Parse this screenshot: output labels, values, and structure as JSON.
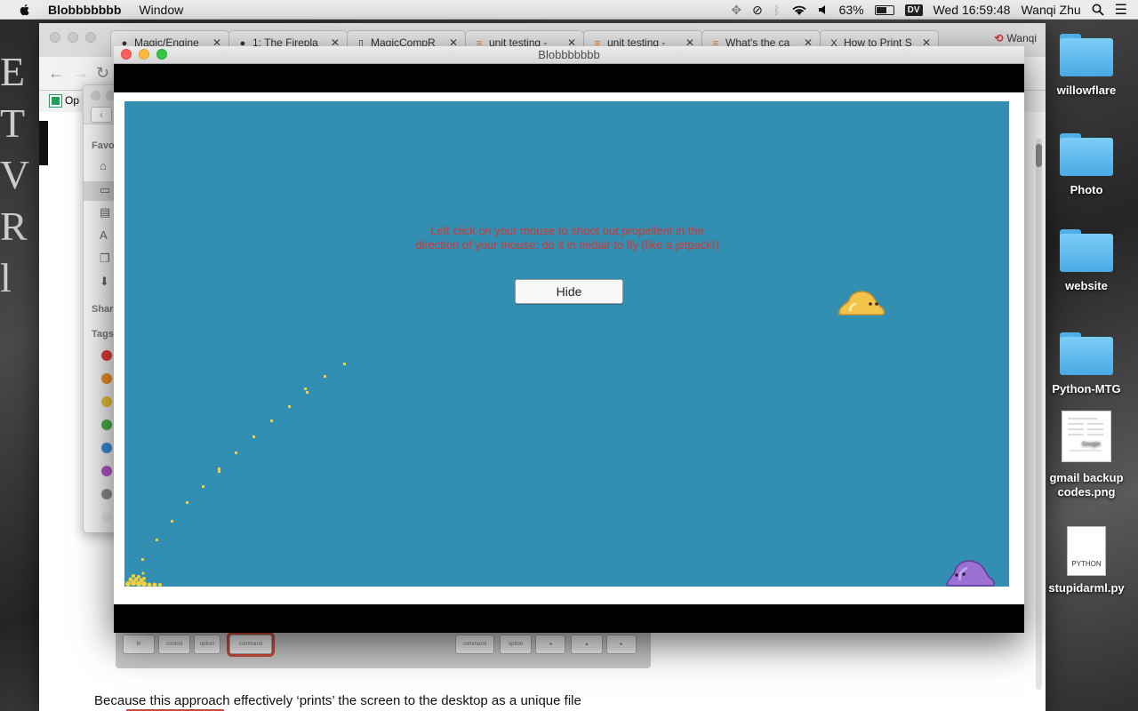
{
  "menubar": {
    "app_name": "Blobbbbbbb",
    "menus": [
      "Window"
    ],
    "battery_percent": "63%",
    "battery_level": 0.63,
    "dv_badge": "DV",
    "clock": "Wed 16:59:48",
    "user": "Wanqi Zhu"
  },
  "browser": {
    "tabs": [
      {
        "label": "Magic/Engine",
        "icon": "github-icon"
      },
      {
        "label": "1: The Firepla",
        "icon": "github-icon"
      },
      {
        "label": "MagicCompR",
        "icon": "document-icon"
      },
      {
        "label": "unit testing - ",
        "icon": "stackoverflow-icon"
      },
      {
        "label": "unit testing - ",
        "icon": "stackoverflow-icon"
      },
      {
        "label": "What's the ca",
        "icon": "stackoverflow-icon"
      },
      {
        "label": "How to Print S",
        "icon": "x-icon"
      }
    ],
    "profile": "Wanqi",
    "bookmark": "Op",
    "article_text": "Because this approach effectively ‘prints’ the screen to the desktop as a unique file",
    "keys": [
      "fn",
      "control",
      "option",
      "command",
      "command",
      "option",
      "◂",
      "▴",
      "▸"
    ]
  },
  "finder": {
    "sections": [
      "Favo",
      "Share",
      "Tags"
    ],
    "tag_colors": [
      "#e0403a",
      "#f08f2a",
      "#e6c23a",
      "#4cb04a",
      "#3a8fd6",
      "#b058c6",
      "#8e8e8e",
      "#e8e8e8"
    ]
  },
  "game": {
    "title": "Blobbbbbbb",
    "hint_text": "Left click on your mouse to shoot out propellent in the direction of your mouse: do it in midair to fly (like a jetpack!)",
    "hide_button": "Hide",
    "colors": {
      "sky": "#338fb2",
      "hint": "#d8352f",
      "propellant": "#f2cf3c",
      "player_blob": "#f3c44a",
      "enemy_blob": "#9b6fd3"
    }
  },
  "desktop": {
    "icons": [
      {
        "label": "willowflare",
        "kind": "folder-icon"
      },
      {
        "label": "Photo",
        "kind": "folder-icon"
      },
      {
        "label": "website",
        "kind": "folder-icon"
      },
      {
        "label": "Python-MTG",
        "kind": "folder-icon"
      },
      {
        "label": "gmail backup codes.png",
        "kind": "image-file-icon"
      },
      {
        "label": "stupidarml.py",
        "kind": "python-file-icon",
        "badge": "PYTHON"
      }
    ]
  }
}
